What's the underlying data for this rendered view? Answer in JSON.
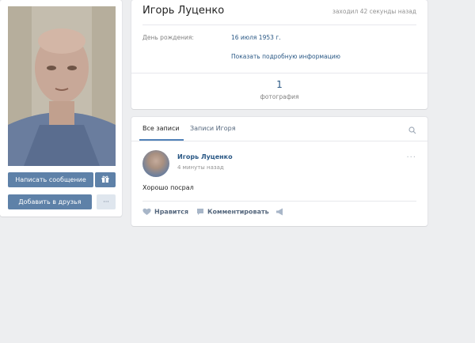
{
  "profile": {
    "name": "Игорь Луценко",
    "last_seen": "заходил 42 секунды назад",
    "birthday_label": "День рождения:",
    "birthday_value": "16 июля 1953 г.",
    "more_info_link": "Показать подробную информацию",
    "photos_count": "1",
    "photos_label": "фотография"
  },
  "actions": {
    "write_message": "Написать сообщение",
    "add_friend": "Добавить в друзья",
    "more": "···"
  },
  "wall": {
    "tabs": [
      {
        "label": "Все записи",
        "active": true
      },
      {
        "label": "Записи Игоря",
        "active": false
      }
    ],
    "post": {
      "author": "Игорь Луценко",
      "time": "4 минуты назад",
      "text": "Хорошо посрал",
      "menu": "···",
      "like_label": "Нравится",
      "comment_label": "Комментировать"
    }
  },
  "colors": {
    "background": "#edeef0",
    "link": "#2a5885",
    "button_primary": "#5e81a8",
    "button_secondary": "#dfe6ee",
    "tab_underline": "#5181b8"
  }
}
